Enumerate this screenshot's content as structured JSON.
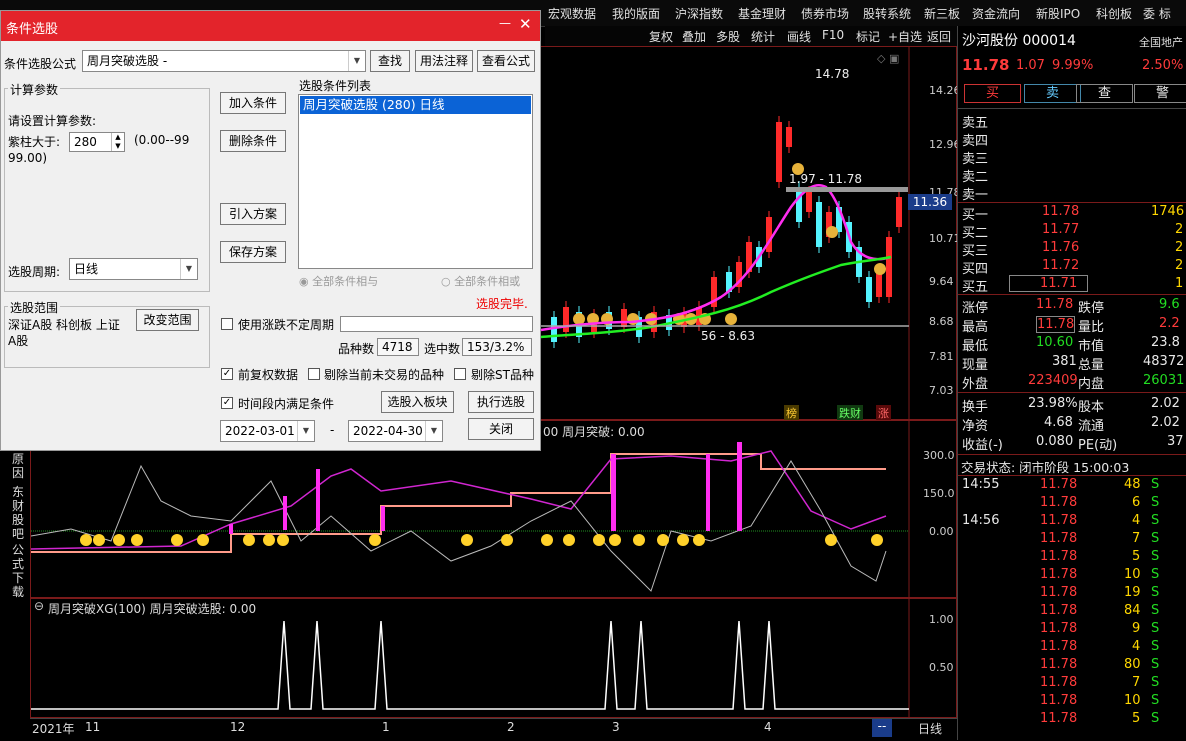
{
  "top_menu": [
    "宏观数据",
    "我的版面",
    "沪深指数",
    "基金理财",
    "债券市场",
    "股转系统",
    "新三板",
    "资金流向",
    "新股IPO",
    "科创板",
    "委 标"
  ],
  "toolbar": [
    "复权",
    "叠加",
    "多股",
    "统计",
    "画线",
    "F10",
    "标记",
    "+自选",
    "返回"
  ],
  "dialog": {
    "title": "条件选股",
    "close_icon": "✕",
    "formula_label": "条件选股公式",
    "formula_value": "周月突破选股 -",
    "btn_find": "查找",
    "btn_usage": "用法注释",
    "btn_view": "查看公式",
    "calc_group": "计算参数",
    "calc_prompt": "请设置计算参数:",
    "param_label": "紫柱大于:",
    "param_value": "280",
    "param_range_1": "(0.00--99",
    "param_range_2": "99.00)",
    "period_label": "选股周期:",
    "period_value": "日线",
    "btn_add": "加入条件",
    "btn_delete": "删除条件",
    "btn_import": "引入方案",
    "btn_save": "保存方案",
    "list_label": "选股条件列表",
    "list_items": [
      "周月突破选股 (280) 日线"
    ],
    "radio_and": "全部条件相与",
    "radio_or": "全部条件相或",
    "status": "选股完毕.",
    "scope_group": "选股范围",
    "scope_text_1": "深证A股 科创板 上证",
    "scope_text_2": "A股",
    "btn_scope": "改变范围",
    "use_limit_label": "使用涨跌不定周期",
    "count_label": "品种数",
    "count_value": "4718",
    "selected_label": "选中数",
    "selected_value": "153/3.2%",
    "cb_adjust": "前复权数据",
    "cb_exclude_untraded": "剔除当前未交易的品种",
    "cb_exclude_st": "剔除ST品种",
    "cb_period": "时间段内满足条件",
    "btn_to_block": "选股入板块",
    "btn_run": "执行选股",
    "date_from": "2022-03-01",
    "date_sep": "-",
    "date_to": "2022-04-30",
    "btn_close": "关闭"
  },
  "chart": {
    "price_axis": [
      "14.26",
      "12.96",
      "11.78",
      "10.71",
      "9.64",
      "8.68",
      "7.81",
      "7.03"
    ],
    "current_price_tag": "11.36",
    "high_label": "14.78",
    "range_label": "1.97 - 11.78",
    "low_label": "56 - 8.63",
    "badges": [
      "榜",
      "跌财",
      "涨"
    ],
    "ind1_title": "00 周月突破: 0.00",
    "ind1_axis": [
      "300.0",
      "150.0",
      "0.00"
    ],
    "ind2_title": "周月突破XG(100) 周月突破选股: 0.00",
    "ind2_axis": [
      "1.00",
      "0.50"
    ],
    "side_labels": [
      "原因",
      "东财股吧",
      "公式下载"
    ],
    "time_axis": [
      "2021年",
      "11",
      "12",
      "1",
      "2",
      "3",
      "4",
      "--"
    ],
    "period": "日线"
  },
  "quote": {
    "name_code": "沙河股份 000014",
    "region": "全国地产",
    "price": "11.78",
    "change": "1.07",
    "pct": "9.99%",
    "pct2": "2.50%",
    "btn_buy": "买",
    "btn_sell": "卖",
    "btn_query": "查",
    "btn_alert": "警",
    "sell_levels": [
      "卖五",
      "卖四",
      "卖三",
      "卖二",
      "卖一"
    ],
    "buy_levels": [
      {
        "label": "买一",
        "price": "11.78",
        "vol": "1746"
      },
      {
        "label": "买二",
        "price": "11.77",
        "vol": "2"
      },
      {
        "label": "买三",
        "price": "11.76",
        "vol": "2"
      },
      {
        "label": "买四",
        "price": "11.72",
        "vol": "2"
      },
      {
        "label": "买五",
        "price": "11.71",
        "vol": "1"
      }
    ],
    "stats": [
      {
        "l1": "涨停",
        "v1": "11.78",
        "l2": "跌停",
        "v2": "9.6"
      },
      {
        "l1": "最高",
        "v1": "11.78",
        "l2": "量比",
        "v2": "2.2"
      },
      {
        "l1": "最低",
        "v1": "10.60",
        "l2": "市值",
        "v2": "23.8"
      },
      {
        "l1": "现量",
        "v1": "381",
        "l2": "总量",
        "v2": "48372"
      },
      {
        "l1": "外盘",
        "v1": "223409",
        "l2": "内盘",
        "v2": "26031"
      }
    ],
    "stats2": [
      {
        "l1": "换手",
        "v1": "23.98%",
        "l2": "股本",
        "v2": "2.02"
      },
      {
        "l1": "净资",
        "v1": "4.68",
        "l2": "流通",
        "v2": "2.02"
      },
      {
        "l1": "收益(-)",
        "v1": "0.080",
        "l2": "PE(动)",
        "v2": "37"
      }
    ],
    "trade_status": "交易状态: 闭市阶段 15:00:03",
    "ticks": [
      {
        "t": "14:55",
        "p": "11.78",
        "v": "48",
        "s": "S"
      },
      {
        "t": "",
        "p": "11.78",
        "v": "6",
        "s": "S"
      },
      {
        "t": "14:56",
        "p": "11.78",
        "v": "4",
        "s": "S"
      },
      {
        "t": "",
        "p": "11.78",
        "v": "7",
        "s": "S"
      },
      {
        "t": "",
        "p": "11.78",
        "v": "5",
        "s": "S"
      },
      {
        "t": "",
        "p": "11.78",
        "v": "10",
        "s": "S"
      },
      {
        "t": "",
        "p": "11.78",
        "v": "19",
        "s": "S"
      },
      {
        "t": "",
        "p": "11.78",
        "v": "84",
        "s": "S"
      },
      {
        "t": "",
        "p": "11.78",
        "v": "9",
        "s": "S"
      },
      {
        "t": "",
        "p": "11.78",
        "v": "4",
        "s": "S"
      },
      {
        "t": "",
        "p": "11.78",
        "v": "80",
        "s": "S"
      },
      {
        "t": "",
        "p": "11.78",
        "v": "7",
        "s": "S"
      },
      {
        "t": "",
        "p": "11.78",
        "v": "10",
        "s": "S"
      },
      {
        "t": "",
        "p": "11.78",
        "v": "5",
        "s": "S"
      }
    ]
  },
  "chart_data": {
    "type": "candlestick",
    "yrange": [
      7.03,
      14.78
    ]
  }
}
